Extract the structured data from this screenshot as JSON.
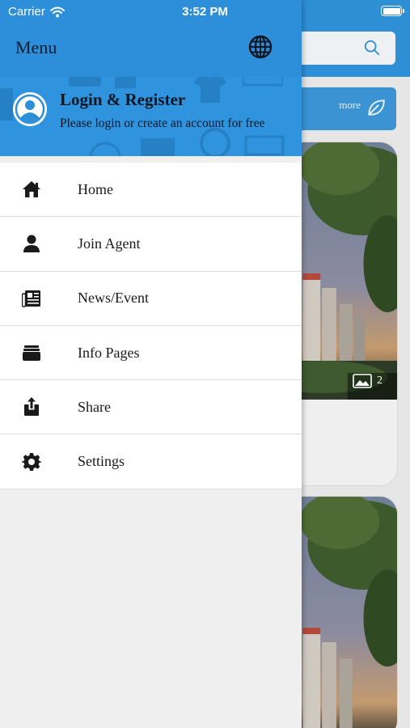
{
  "status_bar": {
    "carrier": "Carrier",
    "time": "3:52 PM"
  },
  "drawer": {
    "title": "Menu",
    "profile": {
      "title": "Login & Register",
      "subtitle": "Please login or create an account for free"
    },
    "items": [
      {
        "label": "Home",
        "icon": "home-icon"
      },
      {
        "label": "Join Agent",
        "icon": "person-icon"
      },
      {
        "label": "News/Event",
        "icon": "newspaper-icon"
      },
      {
        "label": "Info Pages",
        "icon": "folder-icon"
      },
      {
        "label": "Share",
        "icon": "share-icon"
      },
      {
        "label": "Settings",
        "icon": "gear-icon"
      }
    ]
  },
  "background": {
    "more_label": "more",
    "photo_count": "2"
  },
  "colors": {
    "primary": "#2d8fd9",
    "header_bg": "#2f8fd5",
    "text_dark": "#0d1722"
  }
}
